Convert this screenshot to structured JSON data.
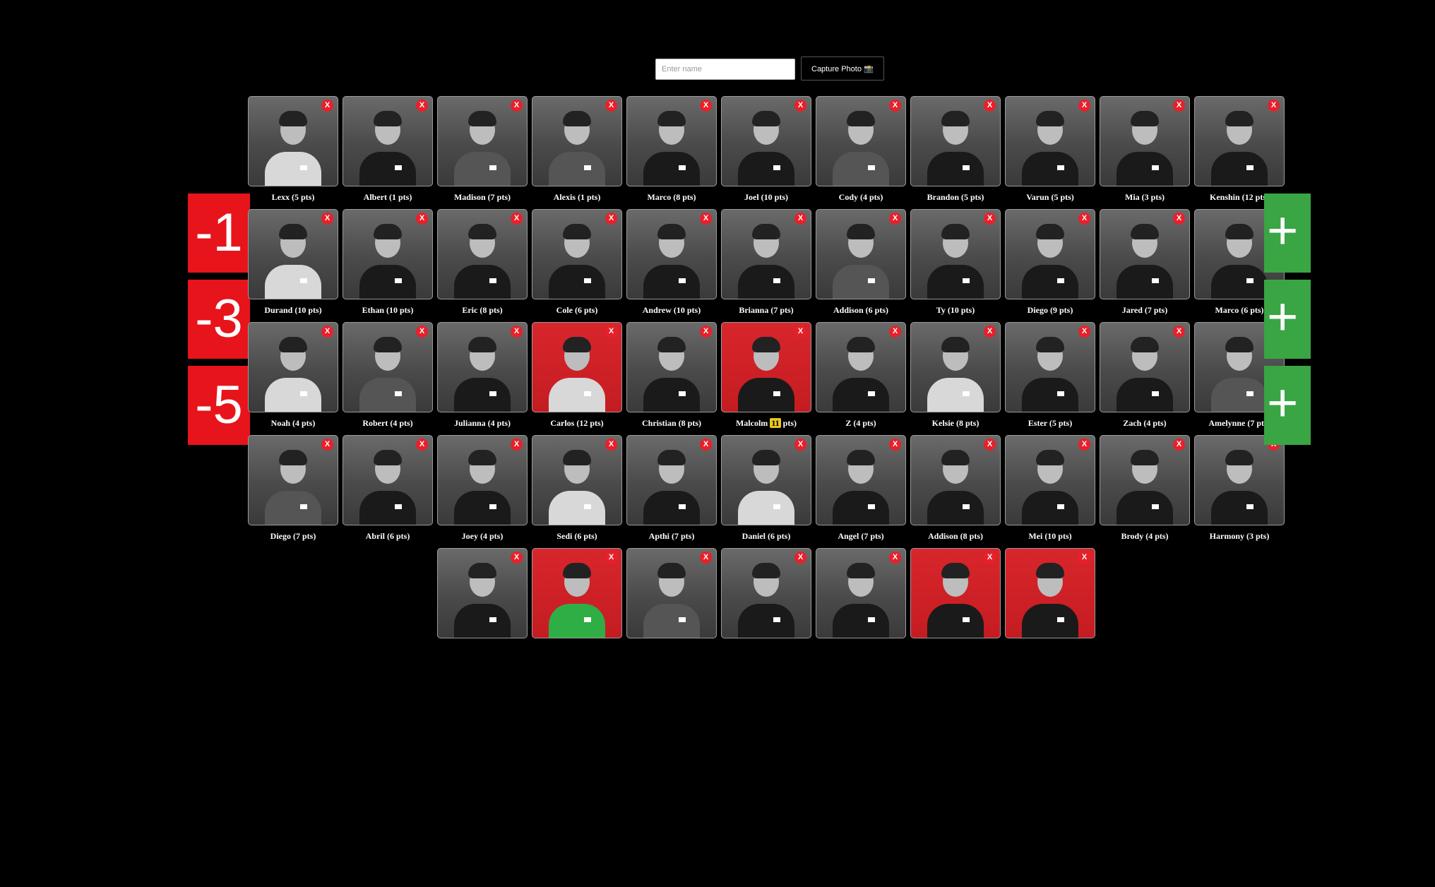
{
  "name_input": {
    "placeholder": "Enter name",
    "value": ""
  },
  "capture_label": "Capture Photo 📸",
  "close_label": "X",
  "left_buttons": [
    "-1",
    "-3",
    "-5"
  ],
  "right_buttons": [
    "+",
    "+",
    "+"
  ],
  "rows": [
    [
      {
        "name": "Lexx (5 pts)",
        "bg": "gray",
        "shirt": "light"
      },
      {
        "name": "Albert (1 pts)",
        "bg": "gray",
        "shirt": "dark"
      },
      {
        "name": "Madison (7 pts)",
        "bg": "gray",
        "shirt": "mid"
      },
      {
        "name": "Alexis (1 pts)",
        "bg": "gray",
        "shirt": "mid"
      },
      {
        "name": "Marco (8 pts)",
        "bg": "gray",
        "shirt": "dark"
      },
      {
        "name": "Joel (10 pts)",
        "bg": "gray",
        "shirt": "dark"
      },
      {
        "name": "Cody (4 pts)",
        "bg": "gray",
        "shirt": "mid"
      },
      {
        "name": "Brandon (5 pts)",
        "bg": "gray",
        "shirt": "dark"
      },
      {
        "name": "Varun (5 pts)",
        "bg": "gray",
        "shirt": "dark"
      },
      {
        "name": "Mia (3 pts)",
        "bg": "gray",
        "shirt": "dark"
      },
      {
        "name": "Kenshin (12 pts)",
        "bg": "gray",
        "shirt": "dark"
      }
    ],
    [
      {
        "name": "Durand (10 pts)",
        "bg": "gray",
        "shirt": "light"
      },
      {
        "name": "Ethan (10 pts)",
        "bg": "gray",
        "shirt": "dark"
      },
      {
        "name": "Eric (8 pts)",
        "bg": "gray",
        "shirt": "dark"
      },
      {
        "name": "Cole (6 pts)",
        "bg": "gray",
        "shirt": "dark"
      },
      {
        "name": "Andrew (10 pts)",
        "bg": "gray",
        "shirt": "dark"
      },
      {
        "name": "Brianna (7 pts)",
        "bg": "gray",
        "shirt": "dark"
      },
      {
        "name": "Addison (6 pts)",
        "bg": "gray",
        "shirt": "mid"
      },
      {
        "name": "Ty (10 pts)",
        "bg": "gray",
        "shirt": "dark"
      },
      {
        "name": "Diego (9 pts)",
        "bg": "gray",
        "shirt": "dark"
      },
      {
        "name": "Jared (7 pts)",
        "bg": "gray",
        "shirt": "dark"
      },
      {
        "name": "Marco (6 pts)",
        "bg": "gray",
        "shirt": "dark"
      }
    ],
    [
      {
        "name": "Noah (4 pts)",
        "bg": "gray",
        "shirt": "light"
      },
      {
        "name": "Robert (4 pts)",
        "bg": "gray",
        "shirt": "mid"
      },
      {
        "name": "Julianna (4 pts)",
        "bg": "gray",
        "shirt": "dark"
      },
      {
        "name": "Carlos (12 pts)",
        "bg": "red",
        "shirt": "light"
      },
      {
        "name": "Christian (8 pts)",
        "bg": "gray",
        "shirt": "dark"
      },
      {
        "name_pre": "Malcolm ",
        "badge": "11",
        "name_post": " pts)",
        "bg": "red",
        "shirt": "dark"
      },
      {
        "name": "Z (4 pts)",
        "bg": "gray",
        "shirt": "dark"
      },
      {
        "name": "Kelsie (8 pts)",
        "bg": "gray",
        "shirt": "light"
      },
      {
        "name": "Ester (5 pts)",
        "bg": "gray",
        "shirt": "dark"
      },
      {
        "name": "Zach (4 pts)",
        "bg": "gray",
        "shirt": "dark"
      },
      {
        "name": "Amelynne (7 pts)",
        "bg": "gray",
        "shirt": "mid"
      }
    ],
    [
      {
        "name": "Diego (7 pts)",
        "bg": "gray",
        "shirt": "mid"
      },
      {
        "name": "Abril (6 pts)",
        "bg": "gray",
        "shirt": "dark"
      },
      {
        "name": "Joey (4 pts)",
        "bg": "gray",
        "shirt": "dark"
      },
      {
        "name": "Sedi (6 pts)",
        "bg": "gray",
        "shirt": "light"
      },
      {
        "name": "Apthi (7 pts)",
        "bg": "gray",
        "shirt": "dark"
      },
      {
        "name": "Daniel (6 pts)",
        "bg": "gray",
        "shirt": "light"
      },
      {
        "name": "Angel (7 pts)",
        "bg": "gray",
        "shirt": "dark"
      },
      {
        "name": "Addison (8 pts)",
        "bg": "gray",
        "shirt": "dark"
      },
      {
        "name": "Mei (10 pts)",
        "bg": "gray",
        "shirt": "dark"
      },
      {
        "name": "Brody (4 pts)",
        "bg": "gray",
        "shirt": "dark"
      },
      {
        "name": "Harmony (3 pts)",
        "bg": "gray",
        "shirt": "dark"
      }
    ],
    [
      {
        "name": "",
        "bg": "gray",
        "shirt": "dark"
      },
      {
        "name": "",
        "bg": "red",
        "shirt": "green"
      },
      {
        "name": "",
        "bg": "gray",
        "shirt": "mid"
      },
      {
        "name": "",
        "bg": "gray",
        "shirt": "dark"
      },
      {
        "name": "",
        "bg": "gray",
        "shirt": "dark"
      },
      {
        "name": "",
        "bg": "red",
        "shirt": "dark"
      },
      {
        "name": "",
        "bg": "red",
        "shirt": "dark"
      }
    ]
  ]
}
